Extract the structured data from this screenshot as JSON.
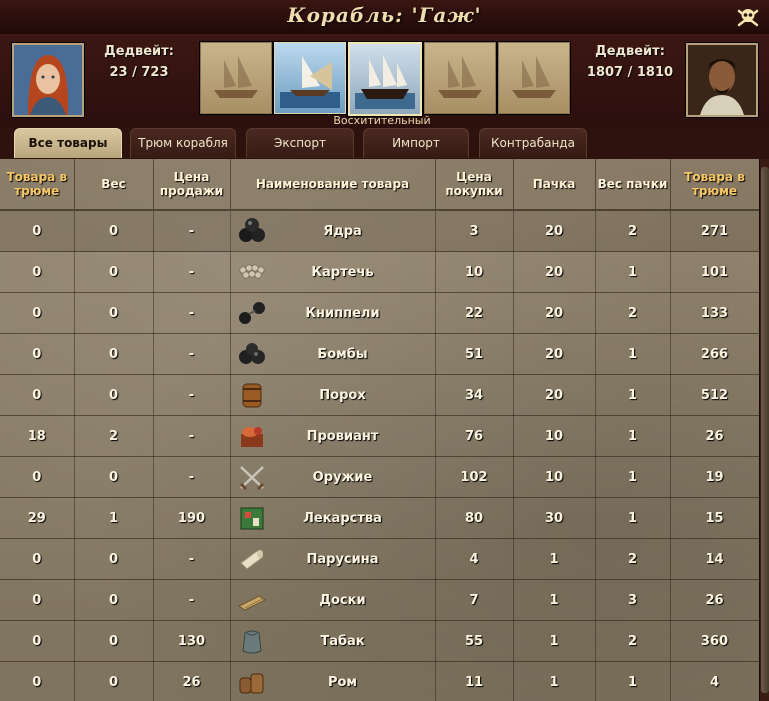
{
  "window": {
    "title": "Корабль: 'Гаж'"
  },
  "left_panel": {
    "deadweight_label": "Дедвейт:",
    "deadweight_value": "23 / 723"
  },
  "right_panel": {
    "deadweight_label": "Дедвейт:",
    "deadweight_value": "1807 / 1810"
  },
  "ship_selector": {
    "selected_name": "Восхитительный"
  },
  "tabs": [
    {
      "label": "Все товары",
      "active": true
    },
    {
      "label": "Трюм корабля",
      "active": false
    },
    {
      "label": "Экспорт",
      "active": false
    },
    {
      "label": "Импорт",
      "active": false
    },
    {
      "label": "Контрабанда",
      "active": false
    }
  ],
  "table": {
    "headers": {
      "in_hold": "Товара в трюме",
      "weight": "Вес",
      "sell_price": "Цена продажи",
      "name": "Наименование товара",
      "buy_price": "Цена покупки",
      "pack": "Пачка",
      "pack_weight": "Вес пачки",
      "store_hold": "Товара в трюме"
    },
    "rows": [
      {
        "in_hold": "0",
        "weight": "0",
        "sell": "-",
        "name": "Ядра",
        "icon": "cannonballs-icon",
        "buy": "3",
        "pack": "20",
        "pack_weight": "2",
        "store": "271"
      },
      {
        "in_hold": "0",
        "weight": "0",
        "sell": "-",
        "name": "Картечь",
        "icon": "grapeshot-icon",
        "buy": "10",
        "pack": "20",
        "pack_weight": "1",
        "store": "101"
      },
      {
        "in_hold": "0",
        "weight": "0",
        "sell": "-",
        "name": "Книппели",
        "icon": "chainshot-icon",
        "buy": "22",
        "pack": "20",
        "pack_weight": "2",
        "store": "133"
      },
      {
        "in_hold": "0",
        "weight": "0",
        "sell": "-",
        "name": "Бомбы",
        "icon": "bombs-icon",
        "buy": "51",
        "pack": "20",
        "pack_weight": "1",
        "store": "266"
      },
      {
        "in_hold": "0",
        "weight": "0",
        "sell": "-",
        "name": "Порох",
        "icon": "powder-barrel-icon",
        "buy": "34",
        "pack": "20",
        "pack_weight": "1",
        "store": "512"
      },
      {
        "in_hold": "18",
        "weight": "2",
        "sell": "-",
        "name": "Провиант",
        "icon": "provisions-icon",
        "buy": "76",
        "pack": "10",
        "pack_weight": "1",
        "store": "26"
      },
      {
        "in_hold": "0",
        "weight": "0",
        "sell": "-",
        "name": "Оружие",
        "icon": "crossed-swords-icon",
        "buy": "102",
        "pack": "10",
        "pack_weight": "1",
        "store": "19"
      },
      {
        "in_hold": "29",
        "weight": "1",
        "sell": "190",
        "name": "Лекарства",
        "icon": "medicine-box-icon",
        "buy": "80",
        "pack": "30",
        "pack_weight": "1",
        "store": "15"
      },
      {
        "in_hold": "0",
        "weight": "0",
        "sell": "-",
        "name": "Парусина",
        "icon": "sailcloth-icon",
        "buy": "4",
        "pack": "1",
        "pack_weight": "2",
        "store": "14"
      },
      {
        "in_hold": "0",
        "weight": "0",
        "sell": "-",
        "name": "Доски",
        "icon": "planks-icon",
        "buy": "7",
        "pack": "1",
        "pack_weight": "3",
        "store": "26"
      },
      {
        "in_hold": "0",
        "weight": "0",
        "sell": "130",
        "name": "Табак",
        "icon": "tobacco-sack-icon",
        "buy": "55",
        "pack": "1",
        "pack_weight": "2",
        "store": "360"
      },
      {
        "in_hold": "0",
        "weight": "0",
        "sell": "26",
        "name": "Ром",
        "icon": "rum-barrels-icon",
        "buy": "11",
        "pack": "1",
        "pack_weight": "1",
        "store": "4"
      }
    ]
  }
}
